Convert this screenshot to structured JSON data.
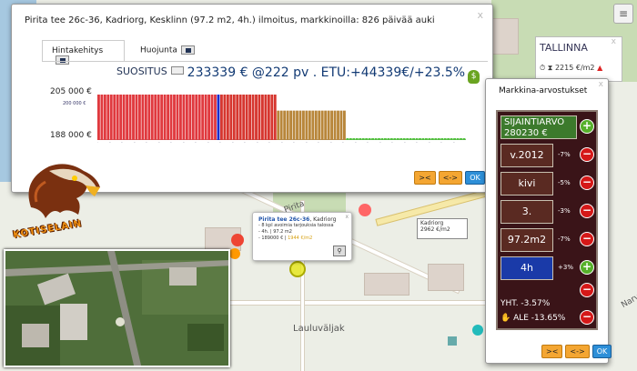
{
  "main_dialog": {
    "title": "Pirita tee 26c-36, Kadriorg, Kesklinn (97.2 m2, 4h.) ilmoitus, markkinoilla: 826 päivää auki",
    "close": "x",
    "tabs": [
      {
        "label": "Hintakehitys",
        "active": true
      },
      {
        "label": "Huojunta",
        "active": false
      }
    ],
    "suositus": {
      "label": "SUOSITUS",
      "value": "233339 € @222 pv . ETU:+44339€/+23.5%",
      "money_icon": "$"
    },
    "y_labels": {
      "top": "205 000 €",
      "mid": "200 000 €",
      "bottom": "188 000 €"
    },
    "buttons": {
      "collapse": "><",
      "expand": "<->",
      "ok": "OK"
    }
  },
  "chart_data": {
    "type": "bar",
    "ylim": [
      188000,
      205000
    ],
    "ytick_labels": [
      "205 000 €",
      "200 000 €",
      "188 000 €"
    ],
    "series": [
      {
        "color": "#e0393e",
        "count": 38,
        "value": 205000
      },
      {
        "color": "#1b2ccc",
        "count": 1,
        "value": 205000
      },
      {
        "color": "#d6362f",
        "count": 18,
        "value": 205000
      },
      {
        "color": "#b8863a",
        "count": 22,
        "value": 199000
      },
      {
        "color": "#4fc23a",
        "count": 38,
        "value": 188000
      }
    ]
  },
  "right_panel": {
    "city": "TALLINNA",
    "price": "2215 €/m2",
    "trend": "▲",
    "close": "x"
  },
  "market": {
    "title": "Markkina-arvostukset",
    "close": "x",
    "sijaintiarvo": {
      "label": "SIJAINTIARVO",
      "value": "280230 €"
    },
    "rows": [
      {
        "label": "v.2012",
        "pct": "-7%",
        "type": "minus"
      },
      {
        "label": "kivi",
        "pct": "-5%",
        "type": "minus"
      },
      {
        "label": "3.",
        "pct": "-3%",
        "type": "minus"
      },
      {
        "label": "97.2m2",
        "pct": "-7%",
        "type": "minus"
      },
      {
        "label": "4h",
        "pct": "+3%",
        "type": "plus"
      }
    ],
    "yht": "YHT. -3.57%",
    "ale": "ALE -13.65%",
    "buttons": {
      "collapse": "><",
      "expand": "<->",
      "ok": "OK"
    }
  },
  "popup": {
    "title": "Pirita tee 26c-36",
    "subtitle": ", Kadriorg",
    "line1": "- 8 kpl avoimia tarjouksia talossa",
    "line2": "- 4h. | 97.2 m2",
    "line3": "- 189000 € |",
    "line3b": "1944 €/m2",
    "close": "x"
  },
  "kadriorg_box": {
    "name": "Kadriorg",
    "price": "2962 €/m2"
  },
  "map_labels": {
    "street1": "Lauluväljak",
    "street2": "Pirita",
    "street3": "Narva"
  },
  "logo_text": "KOTISELAIN"
}
